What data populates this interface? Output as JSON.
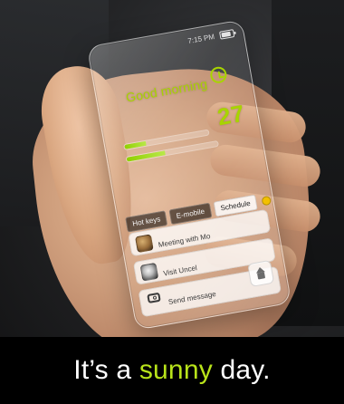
{
  "photo": {
    "caption": {
      "prefix": "It’s a ",
      "highlight": "sunny",
      "suffix": " day."
    }
  },
  "phone": {
    "statusbar": {
      "time": "7:15 PM",
      "battery": {
        "level": 0.7,
        "icon": "battery-icon"
      }
    },
    "greeting": "Good morning",
    "alarm_icon": "alarm-clock-icon",
    "big_number": "27",
    "progress": [
      {
        "fill": 0.26
      },
      {
        "fill": 0.42
      }
    ],
    "tabs": [
      {
        "label": "Hot keys",
        "active": false
      },
      {
        "label": "E-mobile",
        "active": false
      },
      {
        "label": "Schedule",
        "active": true
      }
    ],
    "notification_icon": "notification-dot-icon",
    "rows": [
      {
        "sub": "",
        "title": "Meeting with Mo",
        "avatar": "avatar"
      },
      {
        "sub": "",
        "title": "Visit Uncel",
        "avatar": "avatar"
      },
      {
        "sub": "",
        "title": "Send message",
        "avatar": "camera-icon"
      }
    ],
    "action_icon": "home-icon"
  },
  "colors": {
    "accent": "#b8e31a",
    "ui_green": "#a8d400",
    "notification": "#f3c000"
  }
}
